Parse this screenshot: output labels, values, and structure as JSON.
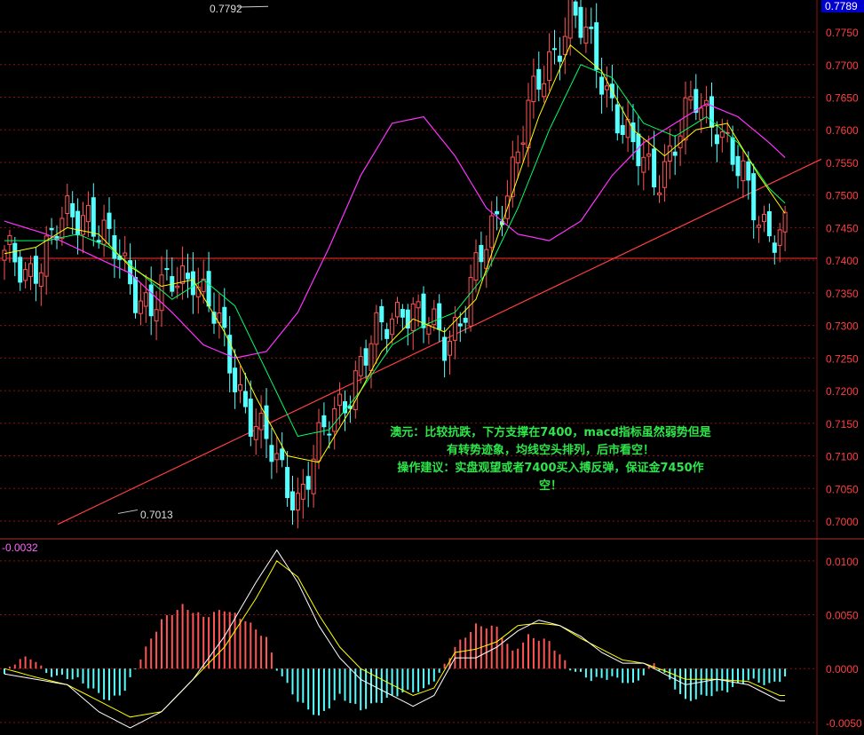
{
  "chart_data": [
    {
      "type": "candlestick",
      "panel": "main",
      "current_price": "0.7789",
      "ylim": [
        0.6985,
        0.7795
      ],
      "y_ticks": [
        "0.7750",
        "0.7700",
        "0.7650",
        "0.7600",
        "0.7550",
        "0.7500",
        "0.7450",
        "0.7400",
        "0.7350",
        "0.7300",
        "0.7250",
        "0.7200",
        "0.7150",
        "0.7100",
        "0.7050",
        "0.7000"
      ],
      "high_label": "0.7792",
      "low_label": "0.7013",
      "support_level": 0.7403,
      "trendline": [
        {
          "x": 65,
          "y": 0.6995
        },
        {
          "x": 925,
          "y": 0.7555
        }
      ],
      "x_count": 150,
      "close_points": [
        [
          0,
          0.74
        ],
        [
          4,
          0.738
        ],
        [
          8,
          0.742
        ],
        [
          12,
          0.746
        ],
        [
          16,
          0.748
        ],
        [
          20,
          0.742
        ],
        [
          24,
          0.737
        ],
        [
          28,
          0.733
        ],
        [
          32,
          0.736
        ],
        [
          36,
          0.739
        ],
        [
          40,
          0.731
        ],
        [
          44,
          0.722
        ],
        [
          48,
          0.715
        ],
        [
          52,
          0.708
        ],
        [
          56,
          0.704
        ],
        [
          60,
          0.711
        ],
        [
          64,
          0.718
        ],
        [
          68,
          0.724
        ],
        [
          72,
          0.729
        ],
        [
          76,
          0.734
        ],
        [
          80,
          0.73
        ],
        [
          84,
          0.728
        ],
        [
          88,
          0.733
        ],
        [
          92,
          0.742
        ],
        [
          96,
          0.752
        ],
        [
          100,
          0.762
        ],
        [
          104,
          0.771
        ],
        [
          108,
          0.778
        ],
        [
          112,
          0.772
        ],
        [
          116,
          0.765
        ],
        [
          120,
          0.756
        ],
        [
          124,
          0.753
        ],
        [
          128,
          0.758
        ],
        [
          132,
          0.764
        ],
        [
          136,
          0.762
        ],
        [
          140,
          0.753
        ],
        [
          144,
          0.747
        ],
        [
          148,
          0.744
        ]
      ],
      "ma_fast_points": [
        [
          0,
          0.741
        ],
        [
          6,
          0.742
        ],
        [
          12,
          0.745
        ],
        [
          18,
          0.744
        ],
        [
          24,
          0.739
        ],
        [
          30,
          0.736
        ],
        [
          36,
          0.737
        ],
        [
          42,
          0.729
        ],
        [
          48,
          0.719
        ],
        [
          54,
          0.71
        ],
        [
          60,
          0.709
        ],
        [
          66,
          0.717
        ],
        [
          72,
          0.726
        ],
        [
          78,
          0.731
        ],
        [
          84,
          0.729
        ],
        [
          90,
          0.734
        ],
        [
          96,
          0.748
        ],
        [
          102,
          0.762
        ],
        [
          108,
          0.773
        ],
        [
          114,
          0.769
        ],
        [
          120,
          0.76
        ],
        [
          126,
          0.756
        ],
        [
          132,
          0.76
        ],
        [
          138,
          0.761
        ],
        [
          144,
          0.753
        ],
        [
          150,
          0.746
        ]
      ],
      "ma_slow_points": [
        [
          0,
          0.743
        ],
        [
          8,
          0.743
        ],
        [
          14,
          0.744
        ],
        [
          20,
          0.742
        ],
        [
          26,
          0.738
        ],
        [
          32,
          0.734
        ],
        [
          38,
          0.737
        ],
        [
          44,
          0.733
        ],
        [
          50,
          0.723
        ],
        [
          56,
          0.713
        ],
        [
          62,
          0.714
        ],
        [
          68,
          0.72
        ],
        [
          74,
          0.727
        ],
        [
          80,
          0.73
        ],
        [
          86,
          0.732
        ],
        [
          92,
          0.738
        ],
        [
          98,
          0.748
        ],
        [
          104,
          0.76
        ],
        [
          110,
          0.77
        ],
        [
          116,
          0.768
        ],
        [
          122,
          0.761
        ],
        [
          128,
          0.759
        ],
        [
          134,
          0.762
        ],
        [
          140,
          0.758
        ],
        [
          146,
          0.751
        ],
        [
          150,
          0.748
        ]
      ],
      "ma_trend_points": [
        [
          0,
          0.746
        ],
        [
          8,
          0.744
        ],
        [
          16,
          0.741
        ],
        [
          24,
          0.738
        ],
        [
          32,
          0.732
        ],
        [
          38,
          0.727
        ],
        [
          44,
          0.725
        ],
        [
          50,
          0.726
        ],
        [
          56,
          0.732
        ],
        [
          62,
          0.742
        ],
        [
          68,
          0.753
        ],
        [
          74,
          0.761
        ],
        [
          80,
          0.762
        ],
        [
          86,
          0.756
        ],
        [
          92,
          0.748
        ],
        [
          98,
          0.744
        ],
        [
          104,
          0.743
        ],
        [
          110,
          0.746
        ],
        [
          116,
          0.753
        ],
        [
          122,
          0.758
        ],
        [
          128,
          0.761
        ],
        [
          134,
          0.764
        ],
        [
          140,
          0.762
        ],
        [
          146,
          0.758
        ],
        [
          150,
          0.755
        ]
      ]
    },
    {
      "type": "bar",
      "panel": "macd",
      "top_label": "-0.0032",
      "ylim": [
        -0.006,
        0.0118
      ],
      "y_ticks": [
        "0.0100",
        "0.0050",
        "0.0000",
        "-0.0050"
      ],
      "hist_points": [
        [
          0,
          -0.0005
        ],
        [
          3,
          0.001
        ],
        [
          6,
          0.0008
        ],
        [
          8,
          -0.0005
        ],
        [
          14,
          -0.001
        ],
        [
          20,
          -0.003
        ],
        [
          23,
          -0.002
        ],
        [
          26,
          0.001
        ],
        [
          30,
          0.0045
        ],
        [
          34,
          0.0058
        ],
        [
          38,
          0.0048
        ],
        [
          42,
          0.0055
        ],
        [
          46,
          0.0045
        ],
        [
          50,
          0.0028
        ],
        [
          52,
          0.0
        ],
        [
          56,
          -0.003
        ],
        [
          60,
          -0.0045
        ],
        [
          64,
          -0.0025
        ],
        [
          68,
          -0.0038
        ],
        [
          72,
          -0.003
        ],
        [
          76,
          -0.0022
        ],
        [
          80,
          -0.002
        ],
        [
          83,
          -0.0005
        ],
        [
          86,
          0.002
        ],
        [
          90,
          0.004
        ],
        [
          94,
          0.0038
        ],
        [
          97,
          0.0015
        ],
        [
          100,
          0.003
        ],
        [
          104,
          0.0025
        ],
        [
          108,
          0.0
        ],
        [
          112,
          -0.001
        ],
        [
          116,
          -0.0008
        ],
        [
          120,
          -0.0015
        ],
        [
          124,
          0.0005
        ],
        [
          126,
          -0.0005
        ],
        [
          130,
          -0.003
        ],
        [
          134,
          -0.0025
        ],
        [
          138,
          -0.002
        ],
        [
          142,
          -0.001
        ],
        [
          146,
          -0.0015
        ],
        [
          149,
          -0.0008
        ]
      ],
      "dif_points": [
        [
          0,
          -0.0005
        ],
        [
          6,
          -0.001
        ],
        [
          12,
          -0.0015
        ],
        [
          18,
          -0.004
        ],
        [
          24,
          -0.0055
        ],
        [
          30,
          -0.004
        ],
        [
          36,
          -0.001
        ],
        [
          42,
          0.003
        ],
        [
          48,
          0.008
        ],
        [
          52,
          0.011
        ],
        [
          56,
          0.008
        ],
        [
          60,
          0.004
        ],
        [
          64,
          0.001
        ],
        [
          68,
          -0.001
        ],
        [
          72,
          -0.002
        ],
        [
          78,
          -0.0035
        ],
        [
          82,
          -0.0025
        ],
        [
          86,
          0.001
        ],
        [
          90,
          0.001
        ],
        [
          94,
          0.002
        ],
        [
          98,
          0.0035
        ],
        [
          102,
          0.0045
        ],
        [
          106,
          0.004
        ],
        [
          110,
          0.003
        ],
        [
          114,
          0.0015
        ],
        [
          118,
          0.0005
        ],
        [
          122,
          0.0005
        ],
        [
          126,
          -0.0005
        ],
        [
          130,
          -0.0015
        ],
        [
          136,
          -0.001
        ],
        [
          142,
          -0.0015
        ],
        [
          148,
          -0.003
        ]
      ],
      "dea_points": [
        [
          0,
          0.0
        ],
        [
          6,
          -0.0008
        ],
        [
          12,
          -0.0015
        ],
        [
          18,
          -0.003
        ],
        [
          24,
          -0.0045
        ],
        [
          30,
          -0.004
        ],
        [
          36,
          -0.001
        ],
        [
          42,
          0.002
        ],
        [
          48,
          0.0065
        ],
        [
          52,
          0.01
        ],
        [
          56,
          0.0085
        ],
        [
          60,
          0.005
        ],
        [
          64,
          0.002
        ],
        [
          68,
          0.0
        ],
        [
          72,
          -0.001
        ],
        [
          78,
          -0.0025
        ],
        [
          82,
          -0.0018
        ],
        [
          86,
          0.0015
        ],
        [
          90,
          0.0018
        ],
        [
          94,
          0.0025
        ],
        [
          98,
          0.004
        ],
        [
          102,
          0.0042
        ],
        [
          106,
          0.004
        ],
        [
          110,
          0.0028
        ],
        [
          114,
          0.0018
        ],
        [
          118,
          0.0008
        ],
        [
          122,
          0.0005
        ],
        [
          126,
          -0.0002
        ],
        [
          130,
          -0.001
        ],
        [
          136,
          -0.001
        ],
        [
          142,
          -0.0012
        ],
        [
          148,
          -0.0025
        ]
      ]
    }
  ],
  "annotation": {
    "line1": "澳元：比较抗跌，下方支撑在7400，macd指标虽然弱势但是",
    "line2": "有转势迹象，均线空头排列，后市看空！",
    "line3": "操作建议：实盘观望或者7400买入搏反弹，保证金7450作",
    "line4": "空！"
  },
  "colors": {
    "up": "#ff5555",
    "down": "#55ffff",
    "ma_fast": "#ffff00",
    "ma_slow": "#00ff66",
    "ma_trend": "#ff33ff",
    "trendline": "#ff4040",
    "axis_text": "#ff4040",
    "dif": "#ffffff",
    "dea": "#ffff00",
    "annotation": "#2ee64a",
    "price_tag": "#0000cc"
  }
}
